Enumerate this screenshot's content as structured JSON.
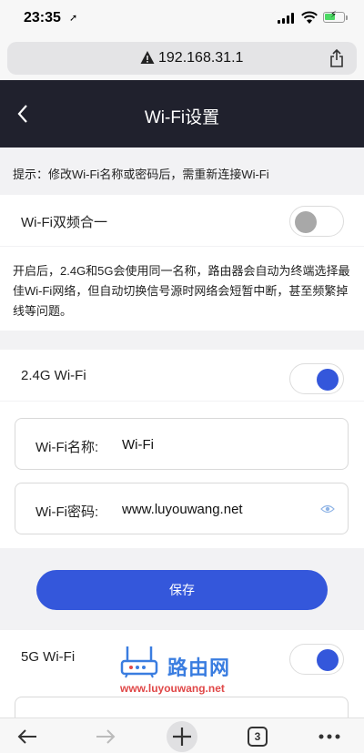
{
  "status_bar": {
    "time": "23:35"
  },
  "browser": {
    "address": "192.168.31.1",
    "tab_count": "3"
  },
  "header": {
    "title": "Wi-Fi设置"
  },
  "tip": "提示：修改Wi-Fi名称或密码后，需重新连接Wi-Fi",
  "dual_band": {
    "label": "Wi-Fi双频合一",
    "enabled": false,
    "description": "开启后，2.4G和5G会使用同一名称，路由器会自动为终端选择最佳Wi-Fi网络，但自动切换信号源时网络会短暂中断，甚至频繁掉线等问题。"
  },
  "band_24g": {
    "label": "2.4G Wi-Fi",
    "enabled": true,
    "name_label": "Wi-Fi名称:",
    "name_value": "Wi-Fi",
    "password_label": "Wi-Fi密码:",
    "password_value": "www.luyouwang.net",
    "save_label": "保存"
  },
  "band_5g": {
    "label": "5G Wi-Fi",
    "enabled": true
  },
  "watermark": {
    "brand": "路由网",
    "url": "www.luyouwang.net"
  },
  "colors": {
    "accent": "#3457db",
    "header_bg": "#20212d",
    "page_bg": "#f2f2f4"
  }
}
